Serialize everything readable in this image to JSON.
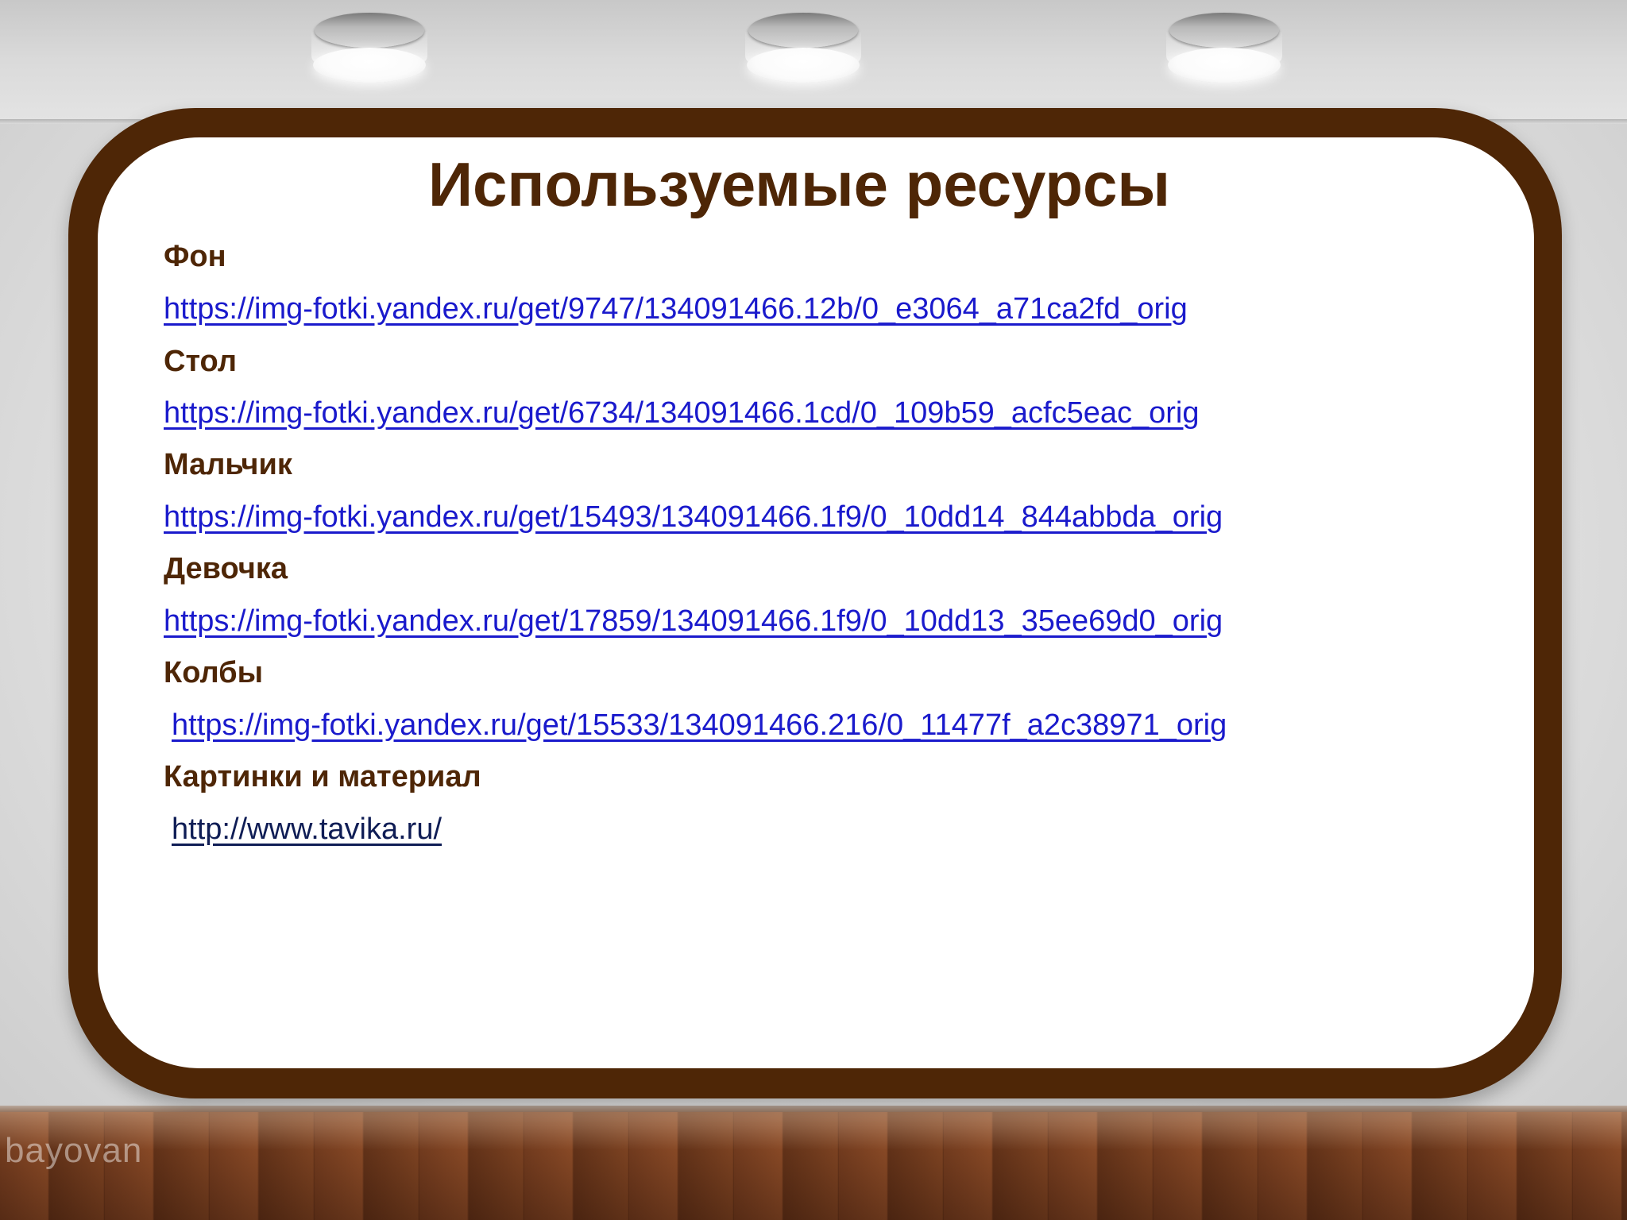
{
  "slide": {
    "title": "Используемые ресурсы",
    "watermark": "bayovan",
    "frame_color": "#4e2606",
    "link_color": "#1a1acc"
  },
  "resources": [
    {
      "label": "Фон",
      "url": "https://img-fotki.yandex.ru/get/9747/134091466.12b/0_e3064_a71ca2fd_orig"
    },
    {
      "label": "Стол",
      "url": "https://img-fotki.yandex.ru/get/6734/134091466.1cd/0_109b59_acfc5eac_orig"
    },
    {
      "label": "Мальчик",
      "url": "https://img-fotki.yandex.ru/get/15493/134091466.1f9/0_10dd14_844abbda_orig"
    },
    {
      "label": "Девочка",
      "url": "https://img-fotki.yandex.ru/get/17859/134091466.1f9/0_10dd13_35ee69d0_orig"
    },
    {
      "label": "Колбы",
      "url": "https://img-fotki.yandex.ru/get/15533/134091466.216/0_11477f_a2c38971_orig"
    },
    {
      "label": "Картинки и материал",
      "url": "http://www.tavika.ru/"
    }
  ]
}
